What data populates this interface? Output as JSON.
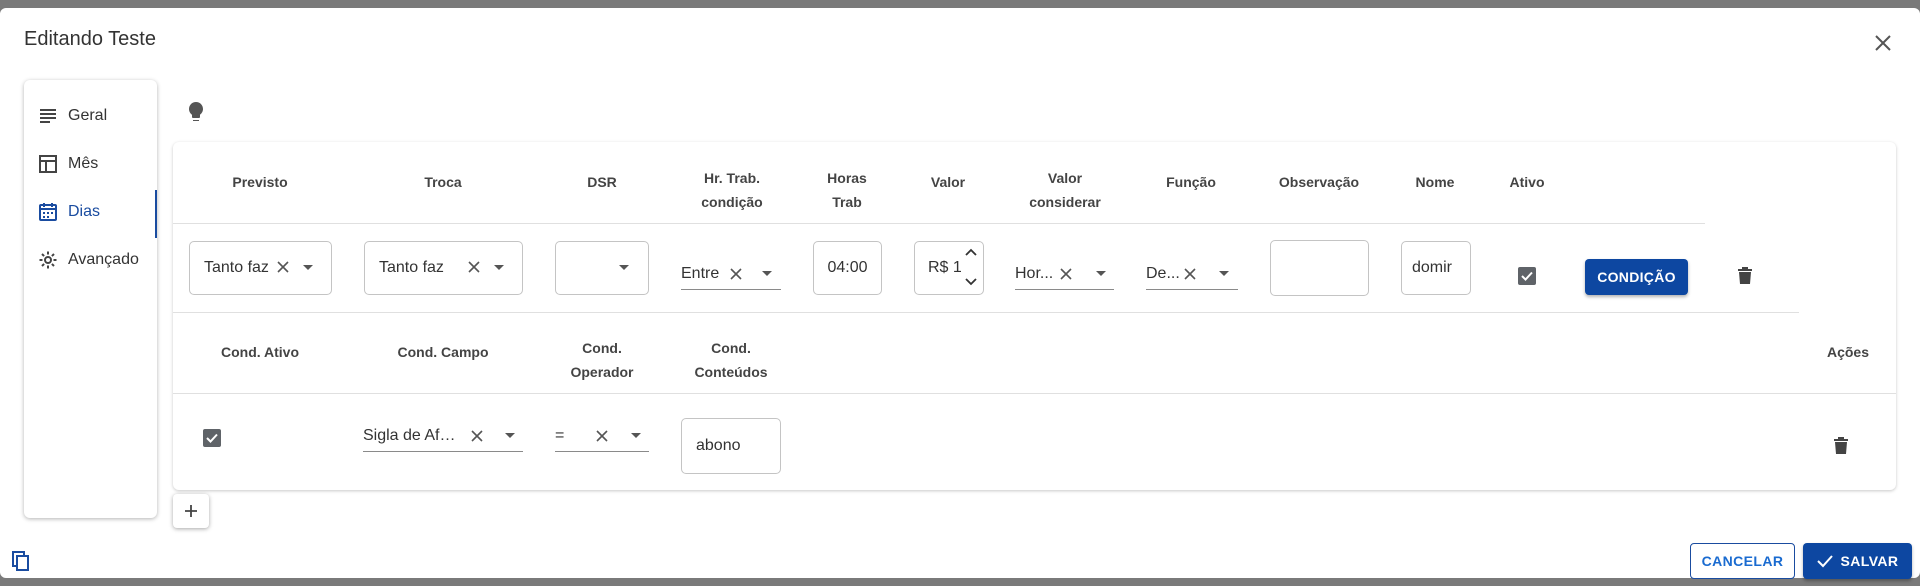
{
  "dialog": {
    "title": "Editando Teste"
  },
  "sidebar": {
    "items": [
      {
        "label": "Geral",
        "icon": "lines-icon"
      },
      {
        "label": "Mês",
        "icon": "table-icon"
      },
      {
        "label": "Dias",
        "icon": "calendar-icon",
        "active": true
      },
      {
        "label": "Avançado",
        "icon": "gear-icon"
      }
    ]
  },
  "rule": {
    "headers": {
      "previsto": "Previsto",
      "troca": "Troca",
      "dsr": "DSR",
      "hr_trab_1": "Hr. Trab.",
      "hr_trab_2": "condição",
      "horas_1": "Horas",
      "horas_2": "Trab",
      "valor": "Valor",
      "valor_cons_1": "Valor",
      "valor_cons_2": "considerar",
      "funcao": "Função",
      "observacao": "Observação",
      "nome": "Nome",
      "ativo": "Ativo"
    },
    "values": {
      "previsto": "Tanto faz",
      "troca": "Tanto faz",
      "dsr": "",
      "hr_trab": "Entre",
      "horas_trab": "04:00",
      "valor": "R$ 1",
      "valor_considerar": "Hor...",
      "funcao": "De...",
      "observacao": "",
      "nome": "domir",
      "ativo": true
    },
    "condicao_label": "CONDIÇÃO"
  },
  "conditions": {
    "headers": {
      "cond_ativo": "Cond. Ativo",
      "cond_campo": "Cond. Campo",
      "cond_operador_1": "Cond.",
      "cond_operador_2": "Operador",
      "cond_conteudos_1": "Cond.",
      "cond_conteudos_2": "Conteúdos",
      "acoes": "Ações"
    },
    "rows": [
      {
        "ativo": true,
        "campo": "Sigla de Afa...",
        "operador": "=",
        "conteudos": "abono"
      }
    ]
  },
  "footer": {
    "cancel_label": "CANCELAR",
    "save_label": "SALVAR"
  },
  "colors": {
    "primary": "#0d47a1",
    "primary_text": "#1a6bd0",
    "checkbox": "#5f6368"
  }
}
